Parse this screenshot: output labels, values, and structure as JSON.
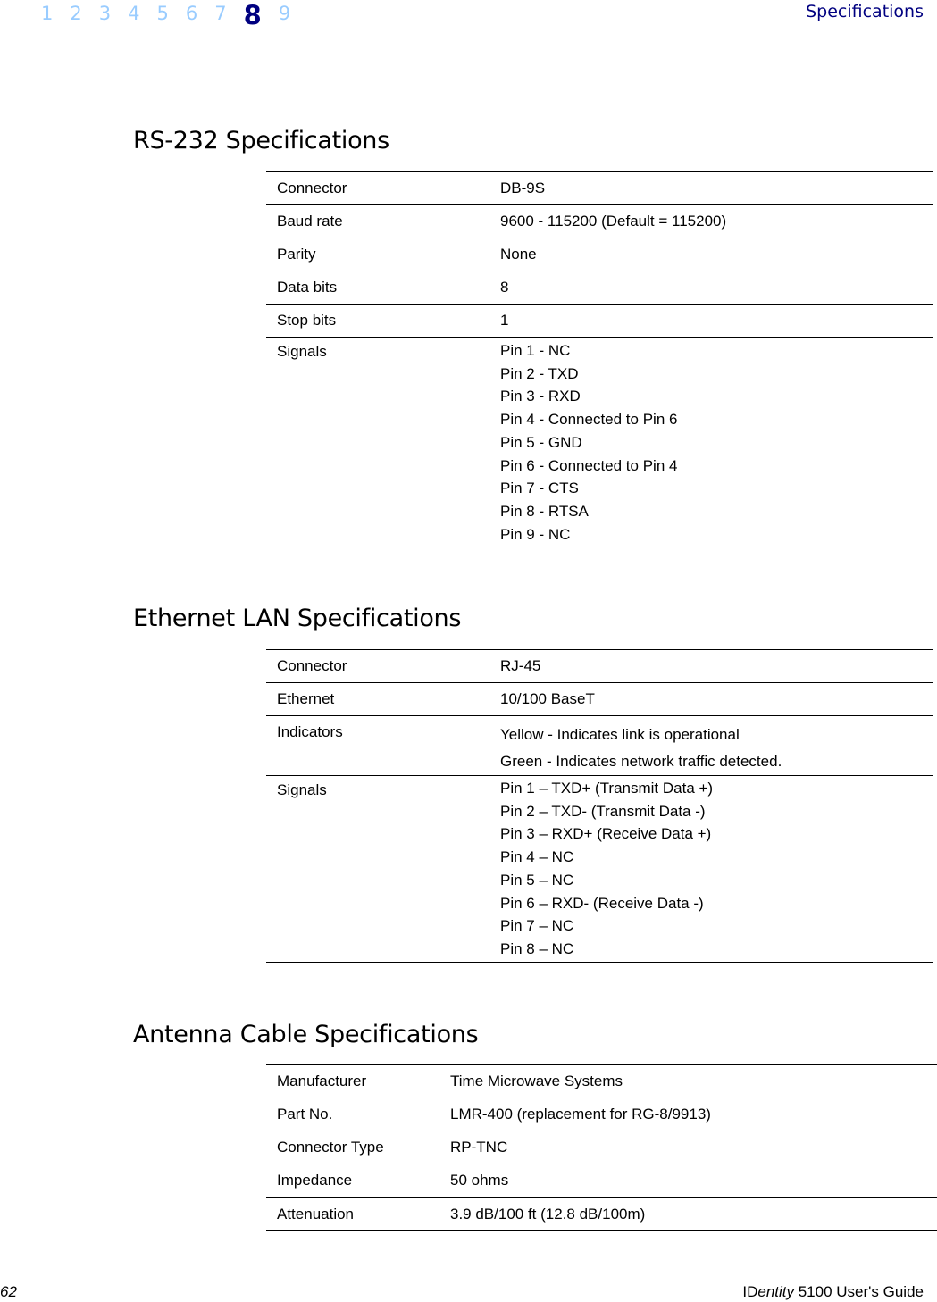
{
  "header": {
    "chapters": [
      "1",
      "2",
      "3",
      "4",
      "5",
      "6",
      "7",
      "8",
      "9"
    ],
    "active_chapter": "8",
    "running_head": "Specifications"
  },
  "sections": {
    "rs232": {
      "title": "RS-232 Specifications",
      "rows": [
        {
          "label": "Connector",
          "value": [
            "DB-9S"
          ]
        },
        {
          "label": "Baud rate",
          "value": [
            "9600 - 115200 (Default = 115200)"
          ]
        },
        {
          "label": "Parity",
          "value": [
            "None"
          ]
        },
        {
          "label": "Data bits",
          "value": [
            "8"
          ]
        },
        {
          "label": "Stop bits",
          "value": [
            "1"
          ]
        },
        {
          "label": "Signals",
          "value": [
            "Pin 1 - NC",
            "Pin 2 - TXD",
            "Pin 3 - RXD",
            "Pin 4 - Connected to Pin 6",
            "Pin 5 - GND",
            "Pin 6 - Connected to Pin 4",
            "Pin 7 - CTS",
            "Pin 8 - RTSA",
            "Pin 9 - NC"
          ]
        }
      ]
    },
    "ethernet": {
      "title": "Ethernet LAN Specifications",
      "rows": [
        {
          "label": "Connector",
          "value": [
            "RJ-45"
          ]
        },
        {
          "label": "Ethernet",
          "value": [
            "10/100 BaseT"
          ]
        },
        {
          "label": "Indicators",
          "value": [
            "Yellow - Indicates link is operational",
            "Green - Indicates network traffic detected."
          ]
        },
        {
          "label": "Signals",
          "value": [
            "Pin 1 – TXD+ (Transmit Data +)",
            "Pin 2 – TXD- (Transmit Data -)",
            "Pin 3 – RXD+ (Receive Data +)",
            "Pin 4 – NC",
            "Pin 5 – NC",
            "Pin 6 – RXD- (Receive Data -)",
            "Pin 7 – NC",
            "Pin 8 – NC"
          ]
        }
      ]
    },
    "antenna": {
      "title": "Antenna Cable Specifications",
      "rows": [
        {
          "label": "Manufacturer",
          "value": [
            "Time Microwave Systems"
          ]
        },
        {
          "label": "Part No.",
          "value": [
            "LMR-400 (replacement for RG-8/9913)"
          ]
        },
        {
          "label": "Connector Type",
          "value": [
            "RP-TNC"
          ]
        },
        {
          "label": "Impedance",
          "value": [
            "50 ohms"
          ]
        },
        {
          "label": "Attenuation",
          "value": [
            "3.9 dB/100 ft (12.8 dB/100m)"
          ]
        }
      ]
    }
  },
  "footer": {
    "page_number": "62",
    "guide_prefix": "ID",
    "guide_italic": "entity",
    "guide_suffix": " 5100 User's Guide"
  }
}
